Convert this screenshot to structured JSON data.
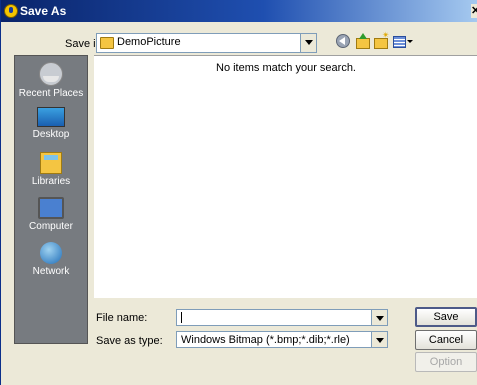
{
  "window": {
    "title": "Save As"
  },
  "toolbar": {
    "save_in_label": "Save in:",
    "save_in_value": "DemoPicture",
    "icons": [
      "back-icon",
      "up-folder-icon",
      "new-folder-icon",
      "views-menu-icon"
    ]
  },
  "places": [
    {
      "label": "Recent Places",
      "icon": "recent-places-icon"
    },
    {
      "label": "Desktop",
      "icon": "desktop-icon"
    },
    {
      "label": "Libraries",
      "icon": "libraries-icon"
    },
    {
      "label": "Computer",
      "icon": "computer-icon"
    },
    {
      "label": "Network",
      "icon": "network-icon"
    }
  ],
  "file_list": {
    "empty_message": "No items match your search."
  },
  "form": {
    "file_name_label": "File name:",
    "file_name_value": "",
    "save_as_type_label": "Save as type:",
    "save_as_type_value": "Windows Bitmap (*.bmp;*.dib;*.rle)"
  },
  "buttons": {
    "save": "Save",
    "cancel": "Cancel",
    "option": "Option"
  },
  "colors": {
    "title_bar": "#0a246a",
    "places_bar": "#777b80",
    "dialog_bg": "#ece9d8"
  }
}
